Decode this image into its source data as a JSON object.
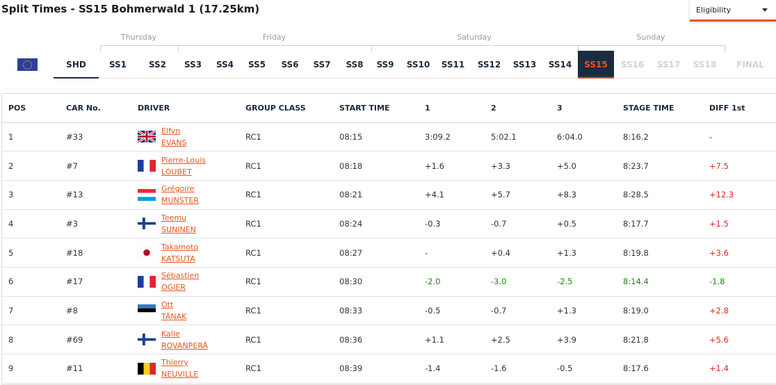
{
  "title": "Split Times - SS15 Bohmerwald 1 (17.25km)",
  "filter": {
    "label": "Eligibility"
  },
  "days": [
    "Thursday",
    "Friday",
    "Saturday",
    "Sunday"
  ],
  "stages": [
    "SHD",
    "SS1",
    "SS2",
    "SS3",
    "SS4",
    "SS5",
    "SS6",
    "SS7",
    "SS8",
    "SS9",
    "SS10",
    "SS11",
    "SS12",
    "SS13",
    "SS14",
    "SS15",
    "SS16",
    "SS17",
    "SS18",
    "FINAL"
  ],
  "active_stage": "SS15",
  "columns": [
    "POS",
    "CAR No.",
    "DRIVER",
    "GROUP CLASS",
    "START TIME",
    "1",
    "2",
    "3",
    "STAGE TIME",
    "DIFF 1st"
  ],
  "rows": [
    {
      "pos": "1",
      "car": "#33",
      "first": "Elfyn",
      "last": "EVANS",
      "flag": "gb",
      "class": "RC1",
      "start": "08:15",
      "s1": "3:09.2",
      "s2": "5:02.1",
      "s3": "6:04.0",
      "stage": "8:16.2",
      "diff": "-"
    },
    {
      "pos": "2",
      "car": "#7",
      "first": "Pierre-Louis",
      "last": "LOUBET",
      "flag": "fr",
      "class": "RC1",
      "start": "08:18",
      "s1": "+1.6",
      "s2": "+3.3",
      "s3": "+5.0",
      "stage": "8:23.7",
      "diff": "+7.5"
    },
    {
      "pos": "3",
      "car": "#13",
      "first": "Grégoire",
      "last": "MUNSTER",
      "flag": "lu",
      "class": "RC1",
      "start": "08:21",
      "s1": "+4.1",
      "s2": "+5.7",
      "s3": "+8.3",
      "stage": "8:28.5",
      "diff": "+12.3"
    },
    {
      "pos": "4",
      "car": "#3",
      "first": "Teemu",
      "last": "SUNINEN",
      "flag": "fi",
      "class": "RC1",
      "start": "08:24",
      "s1": "-0.3",
      "s2": "-0.7",
      "s3": "+0.5",
      "stage": "8:17.7",
      "diff": "+1.5"
    },
    {
      "pos": "5",
      "car": "#18",
      "first": "Takamoto",
      "last": "KATSUTA",
      "flag": "jp",
      "class": "RC1",
      "start": "08:27",
      "s1": "-",
      "s2": "+0.4",
      "s3": "+1.3",
      "stage": "8:19.8",
      "diff": "+3.6"
    },
    {
      "pos": "6",
      "car": "#17",
      "first": "Sébastien",
      "last": "OGIER",
      "flag": "fr",
      "class": "RC1",
      "start": "08:30",
      "s1": "-2.0",
      "s2": "-3.0",
      "s3": "-2.5",
      "stage": "8:14.4",
      "diff": "-1.8",
      "best": true
    },
    {
      "pos": "7",
      "car": "#8",
      "first": "Ott",
      "last": "TÄNAK",
      "flag": "ee",
      "class": "RC1",
      "start": "08:33",
      "s1": "-0.5",
      "s2": "-0.7",
      "s3": "+1.3",
      "stage": "8:19.0",
      "diff": "+2.8"
    },
    {
      "pos": "8",
      "car": "#69",
      "first": "Kalle",
      "last": "ROVANPERÄ",
      "flag": "fi",
      "class": "RC1",
      "start": "08:36",
      "s1": "+1.1",
      "s2": "+2.5",
      "s3": "+3.9",
      "stage": "8:21.8",
      "diff": "+5.6"
    },
    {
      "pos": "9",
      "car": "#11",
      "first": "Thierry",
      "last": "NEUVILLE",
      "flag": "be",
      "class": "RC1",
      "start": "08:39",
      "s1": "-1.4",
      "s2": "-1.6",
      "s3": "-0.5",
      "stage": "8:17.6",
      "diff": "+1.4"
    }
  ],
  "colors": {
    "accent": "#e8541e",
    "navy": "#1c2c40",
    "negative": "#e0291b",
    "best": "#1a8a0a"
  }
}
